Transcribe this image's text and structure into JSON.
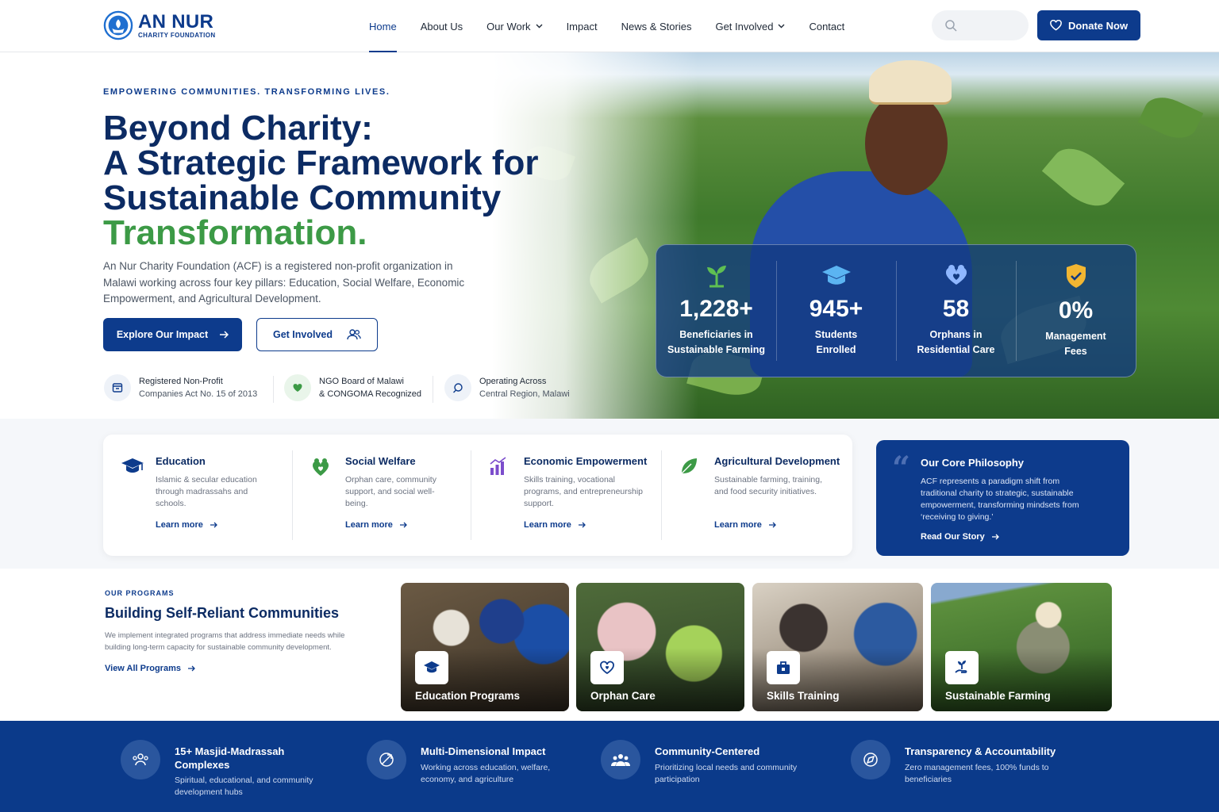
{
  "brand": {
    "name": "AN NUR",
    "subtitle": "CHARITY FOUNDATION"
  },
  "nav": {
    "items": [
      {
        "label": "Home",
        "active": true,
        "dropdown": false
      },
      {
        "label": "About Us",
        "dropdown": false
      },
      {
        "label": "Our Work",
        "dropdown": true
      },
      {
        "label": "Impact",
        "dropdown": false
      },
      {
        "label": "News & Stories",
        "dropdown": false
      },
      {
        "label": "Get Involved",
        "dropdown": true
      },
      {
        "label": "Contact",
        "dropdown": false
      }
    ],
    "search_placeholder": "",
    "donate_label": "Donate Now"
  },
  "hero": {
    "kicker": "EMPOWERING COMMUNITIES. TRANSFORMING LIVES.",
    "title_line1": "Beyond Charity:",
    "title_line2": "A Strategic Framework for",
    "title_line3": "Sustainable Community",
    "title_highlight": "Transformation.",
    "lead": "An Nur Charity Foundation (ACF) is a registered non-profit organization in Malawi working across four key pillars: Education, Social Welfare, Economic Empowerment, and Agricultural Development.",
    "primary_cta": "Explore Our Impact",
    "secondary_cta": "Get Involved",
    "credentials": [
      {
        "title": "Registered Non-Profit",
        "sub": "Companies Act No. 15 of 2013",
        "icon": "registration-icon"
      },
      {
        "title": "NGO Board of Malawi",
        "sub": "& CONGOMA Recognized",
        "icon": "heart-shield-icon"
      },
      {
        "title": "Operating Across",
        "sub": "Central Region, Malawi",
        "icon": "map-pin-icon"
      }
    ],
    "stats": [
      {
        "value": "1,228+",
        "label1": "Beneficiaries in",
        "label2": "Sustainable Farming",
        "icon": "sprout-icon"
      },
      {
        "value": "945+",
        "label1": "Students",
        "label2": "Enrolled",
        "icon": "graduation-cap-icon"
      },
      {
        "value": "58",
        "label1": "Orphans in",
        "label2": "Residential Care",
        "icon": "hands-heart-icon"
      },
      {
        "value": "0%",
        "label1": "Management",
        "label2": "Fees",
        "icon": "shield-check-icon"
      }
    ]
  },
  "pillars": [
    {
      "title": "Education",
      "desc": "Islamic & secular education through madrassahs and schools.",
      "link": "Learn more",
      "icon": "graduation-cap-icon",
      "color": "#0d3b8c"
    },
    {
      "title": "Social Welfare",
      "desc": "Orphan care, community support, and social well-being.",
      "link": "Learn more",
      "icon": "heart-hands-icon",
      "color": "#3c9a46"
    },
    {
      "title": "Economic Empowerment",
      "desc": "Skills training, vocational programs, and entrepreneurship support.",
      "link": "Learn more",
      "icon": "bar-chart-icon",
      "color": "#7c4dcc"
    },
    {
      "title": "Agricultural Development",
      "desc": "Sustainable farming, training, and food security initiatives.",
      "link": "Learn more",
      "icon": "leaf-icon",
      "color": "#3c9a46"
    }
  ],
  "philosophy": {
    "title": "Our Core Philosophy",
    "desc": "ACF represents a paradigm shift from traditional charity to strategic, sustainable empowerment, transforming mindsets from ‘receiving to giving.’",
    "link": "Read Our Story"
  },
  "programs": {
    "kicker": "OUR PROGRAMS",
    "title": "Building Self-Reliant Communities",
    "desc": "We implement integrated programs that address immediate needs while building long-term capacity for sustainable community development.",
    "link": "View All Programs",
    "cards": [
      {
        "label": "Education Programs",
        "icon": "graduation-cap-icon"
      },
      {
        "label": "Orphan Care",
        "icon": "heart-hand-icon"
      },
      {
        "label": "Skills Training",
        "icon": "toolbox-icon"
      },
      {
        "label": "Sustainable Farming",
        "icon": "plant-hand-icon"
      }
    ]
  },
  "features": [
    {
      "title": "15+ Masjid-Madrassah Complexes",
      "desc": "Spiritual, educational, and community development hubs",
      "icon": "people-icon"
    },
    {
      "title": "Multi-Dimensional Impact",
      "desc": "Working across education, welfare, economy, and agriculture",
      "icon": "globe-arrow-icon"
    },
    {
      "title": "Community-Centered",
      "desc": "Prioritizing local needs and community participation",
      "icon": "group-icon"
    },
    {
      "title": "Transparency & Accountability",
      "desc": "Zero management fees, 100% funds to beneficiaries",
      "icon": "compass-icon"
    }
  ]
}
